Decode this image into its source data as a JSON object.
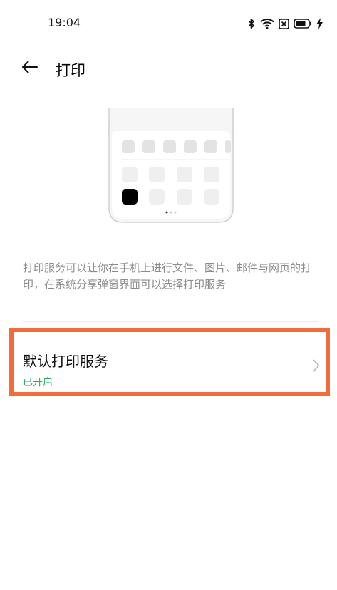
{
  "status_bar": {
    "time": "19:04",
    "icons": [
      "bluetooth-icon",
      "wifi-icon",
      "sim-no-signal-icon",
      "battery-icon",
      "charging-icon"
    ]
  },
  "header": {
    "back_icon": "arrow-left-icon",
    "title": "打印"
  },
  "description": "打印服务可以让你在手机上进行文件、图片、邮件与网页的打印，在系统分享弹窗界面可以选择打印服务",
  "default_print_service": {
    "title": "默认打印服务",
    "status": "已开启",
    "status_color": "#2aaa6a",
    "chevron_icon": "chevron-right-icon"
  },
  "colors": {
    "highlight_border": "#f26b3a",
    "description_text": "#8c8c8c",
    "divider": "#ececec"
  }
}
